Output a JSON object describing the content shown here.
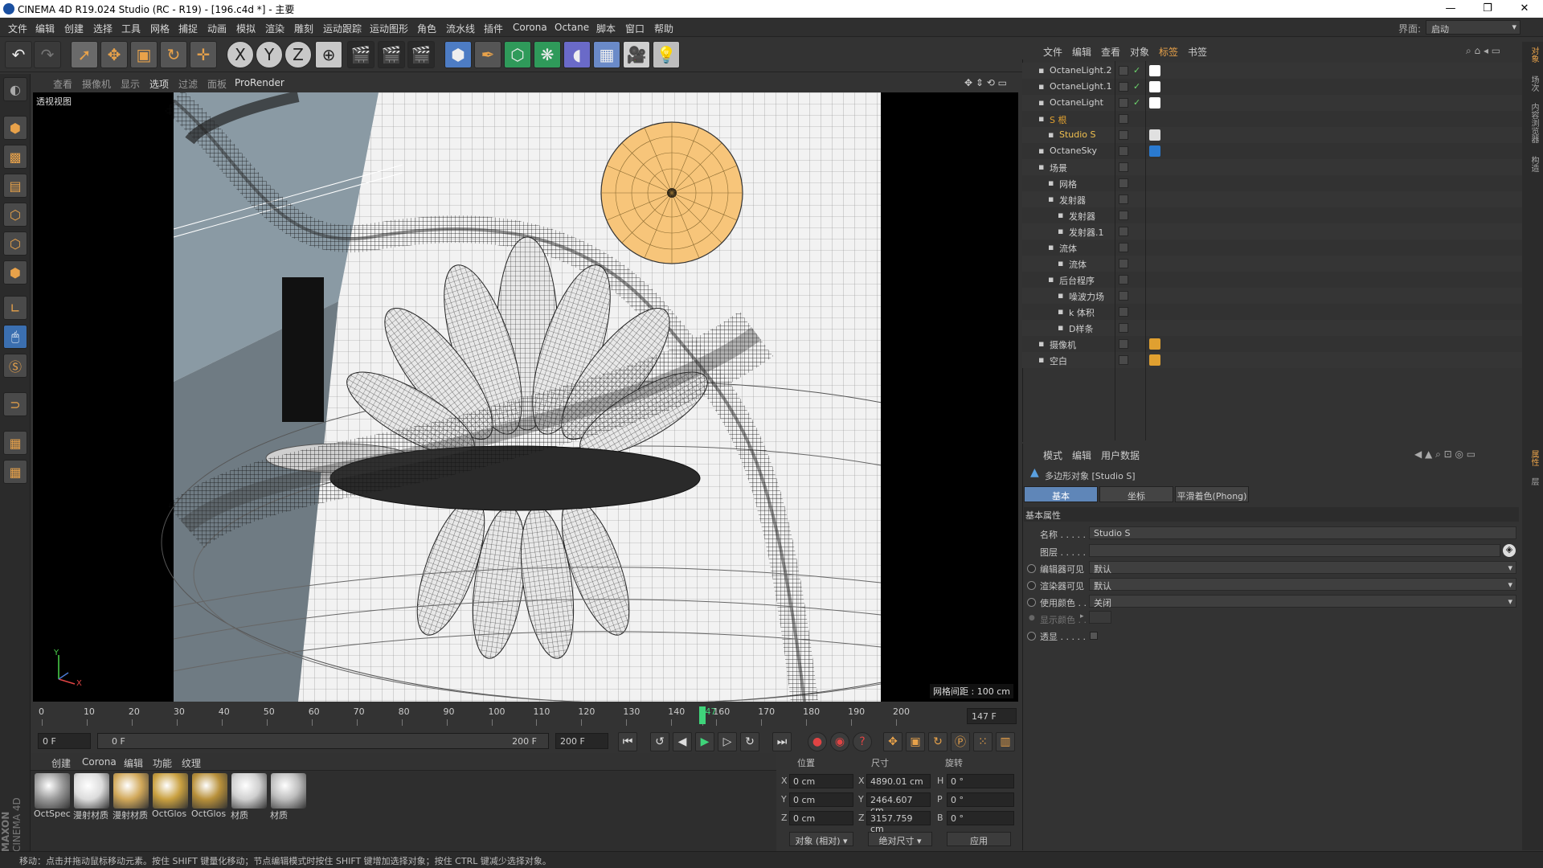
{
  "window": {
    "title": "CINEMA 4D R19.024 Studio (RC - R19) - [196.c4d *] - 主要",
    "controls": [
      "—",
      "❐",
      "✕"
    ]
  },
  "menubar": {
    "items": [
      "文件",
      "编辑",
      "创建",
      "选择",
      "工具",
      "网格",
      "捕捉",
      "动画",
      "模拟",
      "渲染",
      "雕刻",
      "运动跟踪",
      "运动图形",
      "角色",
      "流水线",
      "插件",
      "Corona",
      "Octane",
      "脚本",
      "窗口",
      "帮助"
    ],
    "layout_label": "界面:",
    "layout_value": "启动"
  },
  "toolbar": {
    "axis_x": "X",
    "axis_y": "Y",
    "axis_z": "Z"
  },
  "viewport": {
    "menu": [
      "查看",
      "摄像机",
      "显示",
      "选项",
      "过滤",
      "面板",
      "ProRender"
    ],
    "label": "透视视图",
    "grid_info": "网格间距 : 100 cm",
    "axis_y": "Y",
    "axis_x": "X",
    "colors": {
      "sun": "#f7c57a",
      "lotus": "#7a7a7a",
      "bg": "#000000"
    }
  },
  "timeline": {
    "ticks": [
      "0",
      "10",
      "20",
      "30",
      "40",
      "50",
      "60",
      "70",
      "80",
      "90",
      "100",
      "110",
      "120",
      "130",
      "140",
      "147",
      "160",
      "170",
      "180",
      "190",
      "200"
    ],
    "current_frame_field": "147 F",
    "current_frame": 147,
    "max_frame": 200
  },
  "playbar": {
    "start": "0 F",
    "range_start": "0 F",
    "range_end": "200 F",
    "end": "200 F"
  },
  "materials": {
    "menu": [
      "创建",
      "Corona",
      "编辑",
      "功能",
      "纹理"
    ],
    "items": [
      {
        "label": "OctSpec",
        "color": "#9a9a9a"
      },
      {
        "label": "漫射材质",
        "color": "#dcdcdc"
      },
      {
        "label": "漫射材质",
        "color": "#d1a85a"
      },
      {
        "label": "OctGlos",
        "color": "#c9a040"
      },
      {
        "label": "OctGlos",
        "color": "#b8903a"
      },
      {
        "label": "材质",
        "color": "#cfcfcf"
      },
      {
        "label": "材质",
        "color": "#bdbdbd"
      }
    ]
  },
  "coordinates": {
    "headers": [
      "位置",
      "尺寸",
      "旋转"
    ],
    "rows": [
      {
        "axis": "X",
        "pos": "0 cm",
        "size_axis": "X",
        "size": "4890.01 cm",
        "rot_axis": "H",
        "rot": "0 °"
      },
      {
        "axis": "Y",
        "pos": "0 cm",
        "size_axis": "Y",
        "size": "2464.607 cm",
        "rot_axis": "P",
        "rot": "0 °"
      },
      {
        "axis": "Z",
        "pos": "0 cm",
        "size_axis": "Z",
        "size": "3157.759 cm",
        "rot_axis": "B",
        "rot": "0 °"
      }
    ],
    "mode": "对象 (相对)",
    "size_mode": "绝对尺寸",
    "apply": "应用"
  },
  "object_manager": {
    "menu": [
      "文件",
      "编辑",
      "查看",
      "对象",
      "标签",
      "书签"
    ],
    "rows": [
      {
        "name": "OctaneLight.2",
        "indent": 0,
        "color": "#d0d0d0",
        "check": true,
        "tag": "#ffffff"
      },
      {
        "name": "OctaneLight.1",
        "indent": 0,
        "color": "#d0d0d0",
        "check": true,
        "tag": "#ffffff"
      },
      {
        "name": "OctaneLight",
        "indent": 0,
        "color": "#d0d0d0",
        "check": true,
        "tag": "#ffffff"
      },
      {
        "name": "S 根",
        "indent": 0,
        "color": "#e0a030",
        "check": false,
        "tag": ""
      },
      {
        "name": "Studio S",
        "indent": 1,
        "color": "#f0c050",
        "check": false,
        "tag": "#e0e0e0"
      },
      {
        "name": "OctaneSky",
        "indent": 0,
        "color": "#d0d0d0",
        "check": false,
        "tag": "#2a7ad0"
      },
      {
        "name": "场景",
        "indent": 0,
        "color": "#d0d0d0",
        "check": false,
        "tag": ""
      },
      {
        "name": "网格",
        "indent": 1,
        "color": "#d0d0d0",
        "check": false,
        "tag": ""
      },
      {
        "name": "发射器",
        "indent": 1,
        "color": "#d0d0d0",
        "check": false,
        "tag": ""
      },
      {
        "name": "发射器",
        "indent": 2,
        "color": "#d0d0d0",
        "check": false,
        "tag": ""
      },
      {
        "name": "发射器.1",
        "indent": 2,
        "color": "#d0d0d0",
        "check": false,
        "tag": ""
      },
      {
        "name": "流体",
        "indent": 1,
        "color": "#d0d0d0",
        "check": false,
        "tag": ""
      },
      {
        "name": "流体",
        "indent": 2,
        "color": "#d0d0d0",
        "check": false,
        "tag": ""
      },
      {
        "name": "后台程序",
        "indent": 1,
        "color": "#d0d0d0",
        "check": false,
        "tag": ""
      },
      {
        "name": "噪波力场",
        "indent": 2,
        "color": "#d0d0d0",
        "check": false,
        "tag": ""
      },
      {
        "name": "k 体积",
        "indent": 2,
        "color": "#d0d0d0",
        "check": false,
        "tag": ""
      },
      {
        "name": "D样条",
        "indent": 2,
        "color": "#d0d0d0",
        "check": false,
        "tag": ""
      },
      {
        "name": "摄像机",
        "indent": 0,
        "color": "#d0d0d0",
        "check": false,
        "tag": "#e0a030"
      },
      {
        "name": "空白",
        "indent": 0,
        "color": "#d0d0d0",
        "check": false,
        "tag": "#e0a030"
      }
    ]
  },
  "attributes": {
    "menu": [
      "模式",
      "编辑",
      "用户数据"
    ],
    "object_title": "多边形对象 [Studio S]",
    "tabs": [
      "基本",
      "坐标",
      "平滑着色(Phong)"
    ],
    "section": "基本属性",
    "name_label": "名称 . . . . .",
    "name_value": "Studio S",
    "layer_label": "图层 . . . . .",
    "editor_vis_label": "编辑器可见",
    "editor_vis_value": "默认",
    "render_vis_label": "渲染器可见",
    "render_vis_value": "默认",
    "use_color_label": "使用颜色 . .",
    "use_color_value": "关闭",
    "display_color_label": "显示颜色 . .",
    "xray_label": "透显 . . . . ."
  },
  "right_strip": [
    "对象",
    "场次",
    "内容浏览器",
    "构造",
    "属性",
    "层"
  ],
  "brand": {
    "line1": "MAXON",
    "line2": "CINEMA 4D"
  },
  "status": "移动：点击并拖动鼠标移动元素。按住 SHIFT 键量化移动；节点编辑模式时按住 SHIFT 键增加选择对象；按住 CTRL 键减少选择对象。"
}
